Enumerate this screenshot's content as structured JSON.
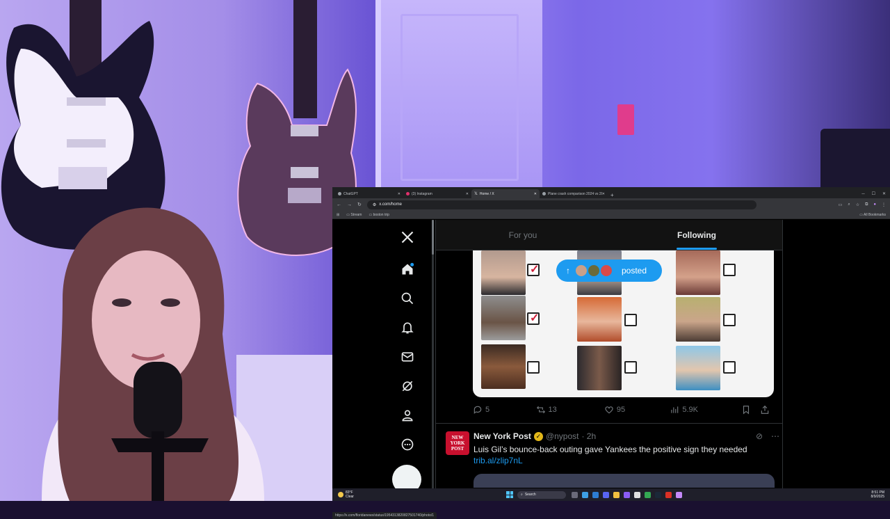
{
  "browser": {
    "tabs": [
      {
        "label": "ChatGPT",
        "active": false
      },
      {
        "label": "(3) Instagram",
        "active": false
      },
      {
        "label": "Home / X",
        "active": true
      },
      {
        "label": "Plane crash comparison 2024 vs 2025",
        "active": false
      }
    ],
    "address": "x.com/home",
    "bookmarks": [
      "Stream",
      "boston trip"
    ],
    "all_bookmarks": "All Bookmarks",
    "status_url": "https://x.com/floridanews/status/1954313820827501740/photo/1"
  },
  "x": {
    "feed_tabs": {
      "for_you": "For you",
      "following": "Following"
    },
    "posted_pill": "posted",
    "tweet1_actions": {
      "replies": "5",
      "reposts": "13",
      "likes": "95",
      "views": "5.9K"
    },
    "tweet2": {
      "logo_text": "NEW YORK POST",
      "name": "New York Post",
      "handle": "@nypost",
      "time": "· 2h",
      "text": "Luis Gil’s bounce-back outing gave Yankees the positive sign they needed",
      "link": "trib.al/zlip7nL"
    }
  },
  "taskbar": {
    "weather_temp": "83°F",
    "weather_desc": "Clear",
    "search": "Search",
    "time": "8:51 PM",
    "date": "8/9/2025"
  },
  "colors": {
    "x_blue": "#1d9bf0",
    "check_red": "#d0203a",
    "nyp_red": "#c8102e"
  }
}
